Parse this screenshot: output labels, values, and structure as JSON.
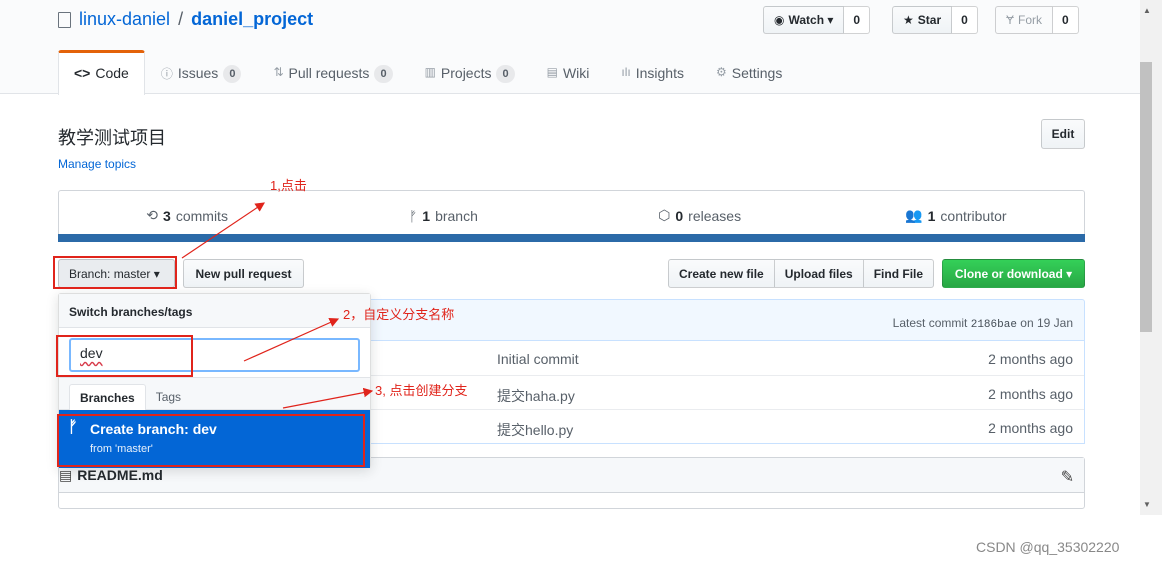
{
  "repo": {
    "owner": "linux-daniel",
    "separator": "/",
    "name": "daniel_project"
  },
  "actions": {
    "watch_label": "Watch ▾",
    "watch_count": "0",
    "star_label": "Star",
    "star_count": "0",
    "fork_label": "Fork",
    "fork_count": "0"
  },
  "nav": {
    "code": "Code",
    "issues": "Issues",
    "issues_count": "0",
    "pulls": "Pull requests",
    "pulls_count": "0",
    "projects": "Projects",
    "projects_count": "0",
    "wiki": "Wiki",
    "insights": "Insights",
    "settings": "Settings"
  },
  "description": "教学测试项目",
  "manage_topics": "Manage topics",
  "edit_label": "Edit",
  "summary": {
    "commits_num": "3",
    "commits_label": "commits",
    "branch_num": "1",
    "branch_label": "branch",
    "releases_num": "0",
    "releases_label": "releases",
    "contributor_num": "1",
    "contributor_label": "contributor"
  },
  "branch_button": "Branch: master ▾",
  "new_pr": "New pull request",
  "file_actions": [
    "Create new file",
    "Upload files",
    "Find File"
  ],
  "clone": "Clone or download ▾",
  "latest_commit": {
    "prefix": "Latest commit",
    "sha": "2186bae",
    "date": "on 19 Jan"
  },
  "files": [
    {
      "message": "Initial commit",
      "age": "2 months ago"
    },
    {
      "message": "提交haha.py",
      "age": "2 months ago"
    },
    {
      "message": "提交hello.py",
      "age": "2 months ago"
    }
  ],
  "readme": "README.md",
  "dropdown": {
    "header": "Switch branches/tags",
    "input_value": "dev",
    "tab_branches": "Branches",
    "tab_tags": "Tags",
    "create_title": "Create branch: dev",
    "create_sub": "from 'master'"
  },
  "annotations": {
    "step1": "1,点击",
    "step2": "2，自定义分支名称",
    "step3": "3, 点击创建分支"
  },
  "watermark": "CSDN @qq_35302220",
  "colors": {
    "annotation": "#e0241b",
    "accent_blue": "#0366d6",
    "green": "#28a745",
    "orange": "#e36209"
  }
}
